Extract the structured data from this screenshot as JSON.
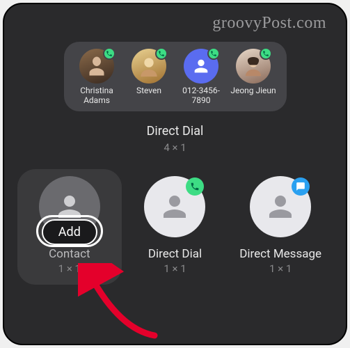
{
  "watermark": "groovyPost.com",
  "strip": {
    "title": "Direct Dial",
    "size": "4 × 1",
    "contacts": [
      {
        "name": "Christina Adams"
      },
      {
        "name": "Steven"
      },
      {
        "name": "012-3456-7890"
      },
      {
        "name": "Jeong Jieun"
      }
    ]
  },
  "widgets": [
    {
      "label": "Contact",
      "size": "1 × 1",
      "add_label": "Add",
      "selected": true
    },
    {
      "label": "Direct Dial",
      "size": "1 × 1",
      "badge": "phone"
    },
    {
      "label": "Direct Message",
      "size": "1 × 1",
      "badge": "message"
    }
  ]
}
